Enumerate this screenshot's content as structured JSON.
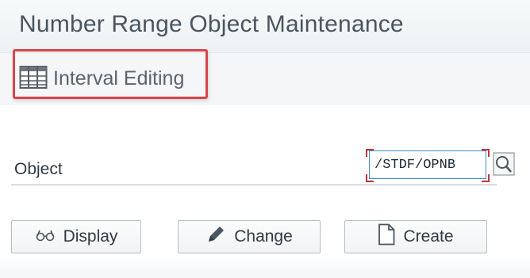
{
  "page": {
    "title": "Number Range Object Maintenance"
  },
  "toolbar": {
    "interval_editing_label": "Interval Editing",
    "interval_editing_icon": "interval-table-icon",
    "highlight_color": "#d9454a"
  },
  "form": {
    "object_label": "Object",
    "object_value": "/STDF/OPNB",
    "value_help_icon": "search-icon",
    "focus_color": "#3d8fc6"
  },
  "buttons": {
    "display_label": "Display",
    "display_icon": "glasses-icon",
    "change_label": "Change",
    "change_icon": "pencil-icon",
    "create_label": "Create",
    "create_icon": "document-icon"
  }
}
